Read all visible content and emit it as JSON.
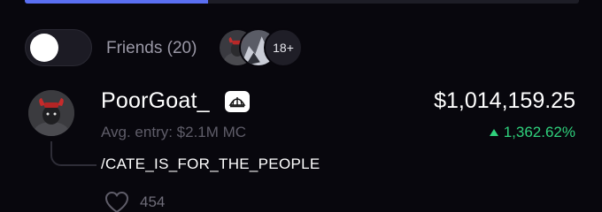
{
  "progress": {
    "value_percent": 33
  },
  "friends": {
    "toggle_on": false,
    "label": "Friends (20)",
    "more_count": "18+"
  },
  "post": {
    "username": "PoorGoat_",
    "avg_entry": "Avg. entry: $2.1M MC",
    "amount": "$1,014,159.25",
    "change": "1,362.62%",
    "comment": "/CATE_IS_FOR_THE_PEOPLE",
    "likes": "454"
  },
  "colors": {
    "background": "#08070d",
    "accent": "#5a6ff2",
    "positive": "#2fd17c",
    "muted": "#5f5d69"
  },
  "icons": {
    "badge": "platform-badge-icon",
    "like": "heart-icon",
    "trend": "triangle-up-icon"
  }
}
